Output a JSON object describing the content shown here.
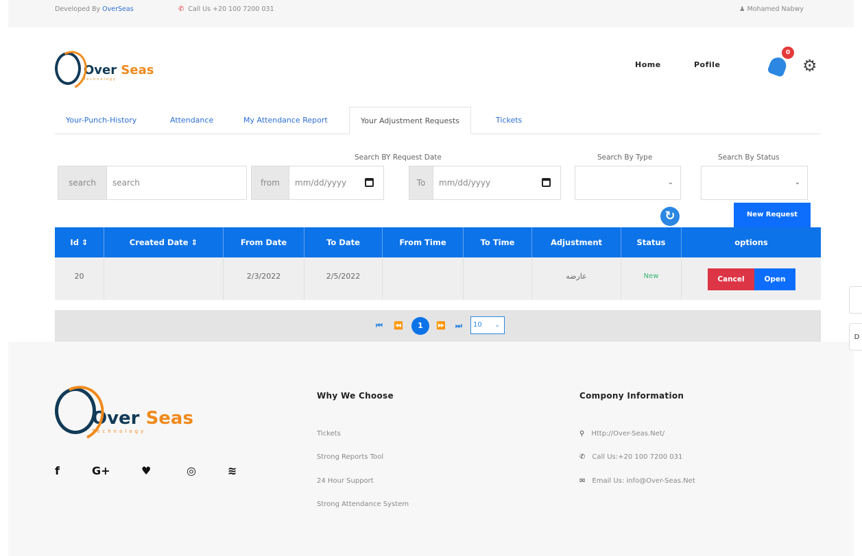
{
  "topbar": {
    "developed_prefix": "Developed By ",
    "developer": "OverSeas",
    "call": "Call Us +20 100 7200 031",
    "user": "Mohamed Nabwy",
    "user_icon": "user-icon",
    "phone_icon": "phone-icon"
  },
  "header": {
    "brand_part1": "Over",
    "brand_part2": " Seas",
    "brand_tag": "Technology",
    "nav": [
      "Home",
      "Pofile"
    ],
    "notification_count": "0",
    "settings_icon": "gear-icon"
  },
  "tabs": [
    {
      "label": "Your-Punch-History",
      "active": false
    },
    {
      "label": "Attendance",
      "active": false
    },
    {
      "label": "My Attendance Report",
      "active": false
    },
    {
      "label": "Your Adjustment Requests",
      "active": true
    },
    {
      "label": "Tickets",
      "active": false
    }
  ],
  "filters": {
    "search_addon": "search",
    "search_placeholder": "search",
    "date_section_label": "Search BY Request Date",
    "from_addon": "from",
    "to_addon": "To",
    "date_placeholder": "mm/dd/yyyy",
    "type_label": "Search By Type",
    "type_value": "",
    "status_label": "Search By Status",
    "status_value": ""
  },
  "actions": {
    "new_request": "New Request",
    "refresh_icon": "refresh-icon"
  },
  "table": {
    "columns": [
      "Id ⇕",
      "Created Date ⇕",
      "From Date",
      "To Date",
      "From Time",
      "To Time",
      "Adjustment",
      "Status",
      "options"
    ],
    "rows": [
      {
        "id": "20",
        "created_date": "",
        "from_date": "2/3/2022",
        "to_date": "2/5/2022",
        "from_time": "",
        "to_time": "",
        "adjustment": "عارضه",
        "status": "New",
        "cancel_label": "Cancel",
        "open_label": "Open"
      }
    ]
  },
  "pagination": {
    "first": "⏮",
    "prev": "⏪",
    "current": "1",
    "next": "⏩",
    "last": "⏭",
    "page_size": "10"
  },
  "footer": {
    "why_heading": "Why We Choose",
    "why_items": [
      "Tickets",
      "Strong Reports Tool",
      "24 Hour Support",
      "Strong Attendance System"
    ],
    "company_heading": "Compony Information",
    "company_items": [
      {
        "icon": "location-icon",
        "text": "Http://Over-Seas.Net/"
      },
      {
        "icon": "phone-icon",
        "text": "Call Us:+20 100 7200 031"
      },
      {
        "icon": "mail-icon",
        "text": "Email Us: info@Over-Seas.Net"
      }
    ],
    "social": [
      "facebook-icon",
      "google-plus-icon",
      "twitter-icon",
      "instagram-icon",
      "rss-icon"
    ]
  },
  "colors": {
    "primary": "#0d73e8",
    "danger": "#dc3545",
    "brand_dark": "#113a57",
    "brand_orange": "#f08a1c",
    "status_new": "#2fb46e"
  }
}
